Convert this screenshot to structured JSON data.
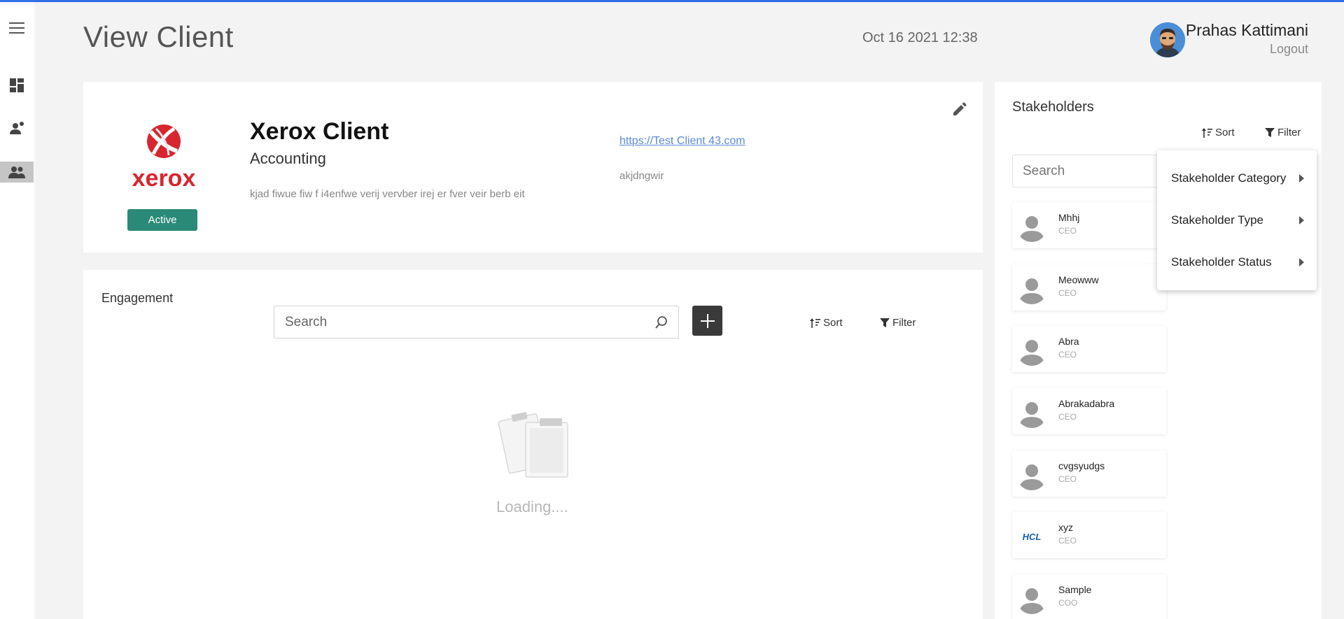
{
  "header": {
    "title": "View Client",
    "datetime": "Oct 16 2021  12:38",
    "user_name": "Prahas Kattimani",
    "logout": "Logout"
  },
  "sidebar": {
    "items": [
      {
        "icon": "menu-icon"
      },
      {
        "icon": "dashboard-icon"
      },
      {
        "icon": "user-add-icon"
      },
      {
        "icon": "group-icon",
        "active": true
      }
    ]
  },
  "client": {
    "logo_text": "xerox",
    "status": "Active",
    "name": "Xerox Client",
    "category": "Accounting",
    "description": "kjad fiwue fiw f i4enfwe verij vervber irej er fver veir berb eit",
    "url": "https://Test Client 43.com",
    "extra": "akjdngwir"
  },
  "engagement": {
    "title": "Engagement",
    "search_placeholder": "Search",
    "sort_label": "Sort",
    "filter_label": "Filter",
    "loading_text": "Loading...."
  },
  "stakeholders": {
    "title": "Stakeholders",
    "sort_label": "Sort",
    "filter_label": "Filter",
    "search_placeholder": "Search",
    "items": [
      {
        "name": "Mhhj",
        "role": "CEO"
      },
      {
        "name": "Meowww",
        "role": "CEO"
      },
      {
        "name": "Abra",
        "role": "CEO"
      },
      {
        "name": "Abrakadabra",
        "role": "CEO"
      },
      {
        "name": "cvgsyudgs",
        "role": "CEO"
      },
      {
        "name": "xyz",
        "role": "CEO",
        "logo": "HCL"
      },
      {
        "name": "Sample",
        "role": "COO"
      }
    ],
    "filter_menu": [
      {
        "label": "Stakeholder Category"
      },
      {
        "label": "Stakeholder Type"
      },
      {
        "label": "Stakeholder Status"
      }
    ]
  },
  "colors": {
    "accent_top": "#2f6fea",
    "active_badge": "#2a8a77",
    "add_button": "#3a3a3a",
    "link": "#5b8ad8"
  }
}
